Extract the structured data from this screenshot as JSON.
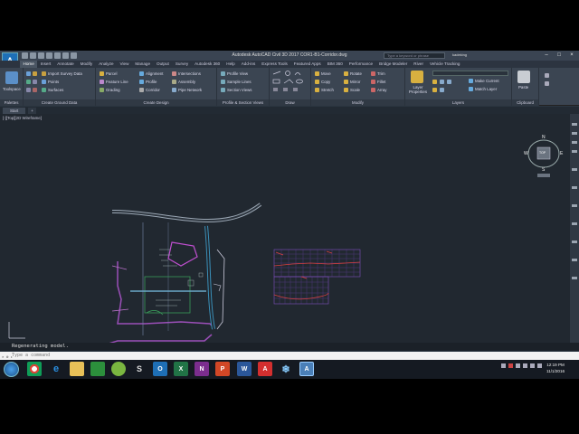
{
  "title_bar": {
    "app_letter": "A",
    "title": "Autodesk AutoCAD Civil 3D 2017    COR1-B1-Corridor.dwg",
    "search_placeholder": "Type a keyword or phrase",
    "user": "kadeking"
  },
  "tabs": [
    "Home",
    "Insert",
    "Annotate",
    "Modify",
    "Analyze",
    "View",
    "Manage",
    "Output",
    "Survey",
    "Autodesk 360",
    "Help",
    "Add-ins",
    "Express Tools",
    "Featured Apps",
    "BIM 360",
    "Performance",
    "Bridge Modeler",
    "River",
    "Vehicle Tracking"
  ],
  "ribbon": {
    "toolspace": "Toolspace",
    "ground": [
      "Import Survey Data",
      "Points",
      "Surfaces"
    ],
    "design1": [
      "Parcel",
      "Feature Line",
      "Grading"
    ],
    "design2": [
      "Alignment",
      "Profile",
      "Corridor"
    ],
    "design3": [
      "Intersections",
      "Assembly",
      "Pipe Network"
    ],
    "profile": [
      "Profile View",
      "Sample Lines",
      "Section Views"
    ],
    "modify": [
      "Move",
      "Copy",
      "Stretch"
    ],
    "modify2": [
      "Rotate",
      "Mirror",
      "Scale"
    ],
    "modify3": [
      "Trim",
      "Fillet",
      "Array"
    ],
    "layer_props": "Layer Properties",
    "layers": [
      "Make Current",
      "Match Layer"
    ],
    "paste": "Paste",
    "panel_titles": {
      "palettes": "Palettes",
      "ground": "Create Ground Data",
      "design": "Create Design",
      "profile": "Profile & Section Views",
      "draw": "Draw",
      "modify": "Modify",
      "layers": "Layers",
      "clipboard": "Clipboard"
    }
  },
  "doc_tabs": {
    "start": "Start",
    "plus": "+"
  },
  "viewport": {
    "label": "[-][Top][2D Wireframe]",
    "viewcube": {
      "n": "N",
      "s": "S",
      "e": "E",
      "w": "W",
      "face": "TOP"
    }
  },
  "command": {
    "history": "Regenerating model.",
    "placeholder": "Type a command"
  },
  "taskbar": {
    "apps": [
      "chrome",
      "ie",
      "explorer",
      "excel-viewer",
      "chat",
      "sway",
      "outlook",
      "excel",
      "onenote",
      "powerpoint",
      "word",
      "acrobat",
      "snowflake",
      "autocad"
    ],
    "time": "12:19 PM",
    "date": "11/1/2016"
  },
  "colors": {
    "accent": "#1e6fb6",
    "viewport_bg": "#212830",
    "ribbon_bg": "#3b4552"
  }
}
